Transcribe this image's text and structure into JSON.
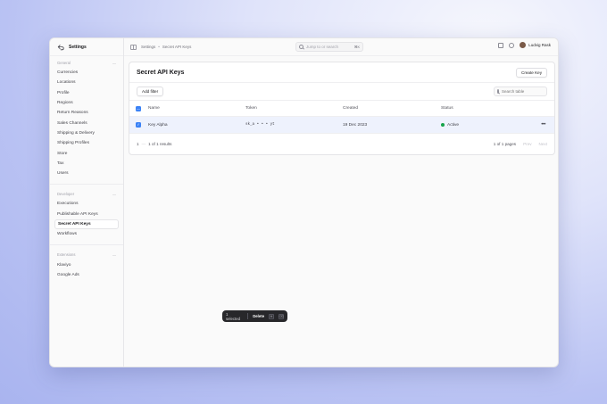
{
  "sidebar": {
    "title": "Settings",
    "general_label": "General",
    "general_items": [
      {
        "label": "Currencies"
      },
      {
        "label": "Locations"
      },
      {
        "label": "Profile"
      },
      {
        "label": "Regions"
      },
      {
        "label": "Return Reasons"
      },
      {
        "label": "Sales Channels"
      },
      {
        "label": "Shipping & Delivery"
      },
      {
        "label": "Shipping Profiles"
      },
      {
        "label": "Store"
      },
      {
        "label": "Tax"
      },
      {
        "label": "Users"
      }
    ],
    "developer_label": "Developer",
    "developer_items": [
      {
        "label": "Executions"
      },
      {
        "label": "Publishable API Keys"
      },
      {
        "label": "Secret API Keys"
      },
      {
        "label": "Workflows"
      }
    ],
    "extensions_label": "Extensions",
    "extensions_items": [
      {
        "label": "Klaviyo"
      },
      {
        "label": "Google Ads"
      }
    ]
  },
  "topbar": {
    "breadcrumb": [
      "Settings",
      "Secret API Keys"
    ],
    "breadcrumb_sep": "•",
    "search_placeholder": "Jump to or search",
    "search_shortcut": "⌘K",
    "user_name": "Ludvig Rask"
  },
  "page": {
    "title": "Secret API Keys",
    "create_button": "Create Key",
    "add_filter_button": "Add filter",
    "search_table_placeholder": "Search table"
  },
  "table": {
    "columns": {
      "name": "Name",
      "token": "Token",
      "created": "Created",
      "status": "Status"
    },
    "rows": [
      {
        "name": "Key Alpha",
        "token": "sk_a • • • yt",
        "created": "19 Dec 2023",
        "status": "Active",
        "more": "•••"
      }
    ]
  },
  "pagination": {
    "range_start": "1",
    "range_dash": "—",
    "range_text": "1 of 1 results",
    "pages_text": "1 of 1 pages",
    "prev": "Prev",
    "next": "Next"
  },
  "action_bar": {
    "selected_text": "1 selected",
    "delete_label": "Delete",
    "delete_key": "⌘",
    "close_key": "⌫"
  },
  "colors": {
    "accent": "#3b82f6",
    "active_status": "#16a34a"
  }
}
